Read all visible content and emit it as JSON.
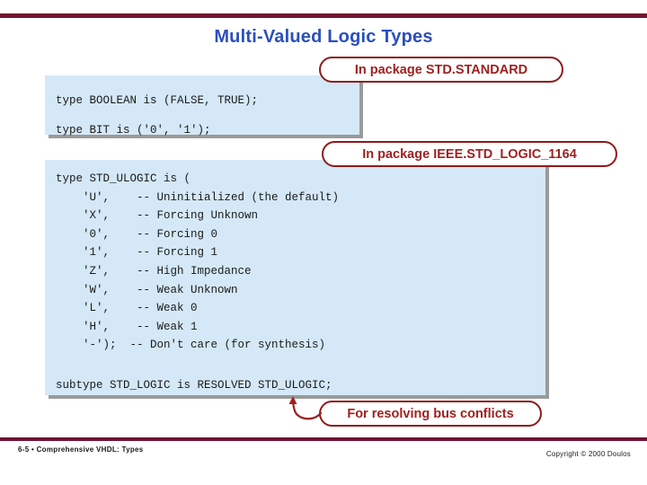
{
  "slide": {
    "title": "Multi-Valued Logic Types",
    "accent_color": "#711430",
    "title_color": "#2a4fbd",
    "callout_color": "#9e2121",
    "code_bg_color": "#d4e8f7"
  },
  "code_blocks": {
    "standard": {
      "lines": [
        "type BOOLEAN is (FALSE, TRUE);",
        "type BIT is ('0', '1');"
      ],
      "text": "type BOOLEAN is (FALSE, TRUE);\ntype BIT is ('0', '1');"
    },
    "std_logic_1164": {
      "lines": [
        "type STD_ULOGIC is (",
        "    'U',    -- Uninitialized (the default)",
        "    'X',    -- Forcing Unknown",
        "    '0',    -- Forcing 0",
        "    '1',    -- Forcing 1",
        "    'Z',    -- High Impedance",
        "    'W',    -- Weak Unknown",
        "    'L',    -- Weak 0",
        "    'H',    -- Weak 1",
        "    '-');  -- Don't care (for synthesis)"
      ],
      "text": "type STD_ULOGIC is (\n    'U',    -- Uninitialized (the default)\n    'X',    -- Forcing Unknown\n    '0',    -- Forcing 0\n    '1',    -- Forcing 1\n    'Z',    -- High Impedance\n    'W',    -- Weak Unknown\n    'L',    -- Weak 0\n    'H',    -- Weak 1\n    '-');  -- Don't care (for synthesis)",
      "subtype_line": "subtype STD_LOGIC is RESOLVED STD_ULOGIC;"
    }
  },
  "callouts": {
    "standard": "In package STD.STANDARD",
    "ieee": "In package IEEE.STD_LOGIC_1164",
    "resolving": "For resolving bus conflicts"
  },
  "footer": {
    "left": "6-5  •  Comprehensive VHDL: Types",
    "right": "Copyright © 2000 Doulos"
  }
}
